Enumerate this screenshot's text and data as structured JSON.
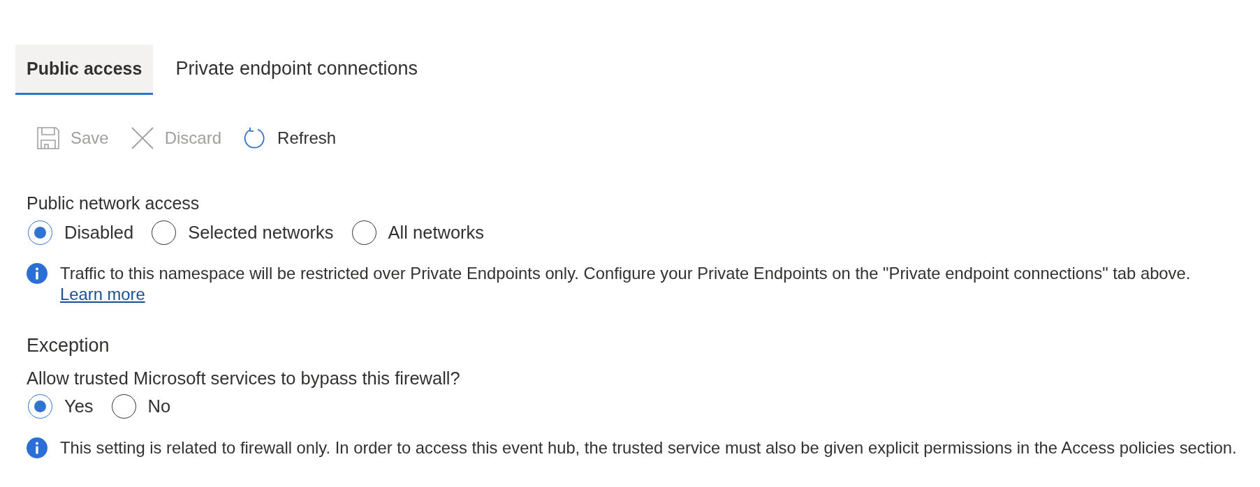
{
  "tabs": [
    {
      "label": "Public access",
      "selected": true
    },
    {
      "label": "Private endpoint connections",
      "selected": false
    }
  ],
  "toolbar": [
    {
      "kind": "save",
      "label": "Save",
      "disabled": true
    },
    {
      "kind": "discard",
      "label": "Discard",
      "disabled": true
    },
    {
      "kind": "refresh",
      "label": "Refresh",
      "disabled": false
    }
  ],
  "public_network_access": {
    "label": "Public network access",
    "options": [
      {
        "label": "Disabled",
        "selected": true
      },
      {
        "label": "Selected networks",
        "selected": false
      },
      {
        "label": "All networks",
        "selected": false
      }
    ],
    "info": {
      "text": "Traffic to this namespace will be restricted over Private Endpoints only. Configure your Private Endpoints on the \"Private endpoint connections\" tab above.",
      "link": "Learn more"
    }
  },
  "exception": {
    "heading": "Exception",
    "question": "Allow trusted Microsoft services to bypass this firewall?",
    "options": [
      {
        "label": "Yes",
        "selected": true
      },
      {
        "label": "No",
        "selected": false
      }
    ],
    "info": {
      "text": "This setting is related to firewall only. In order to access this event hub, the trusted service must also be given explicit permissions in the Access policies section."
    }
  }
}
